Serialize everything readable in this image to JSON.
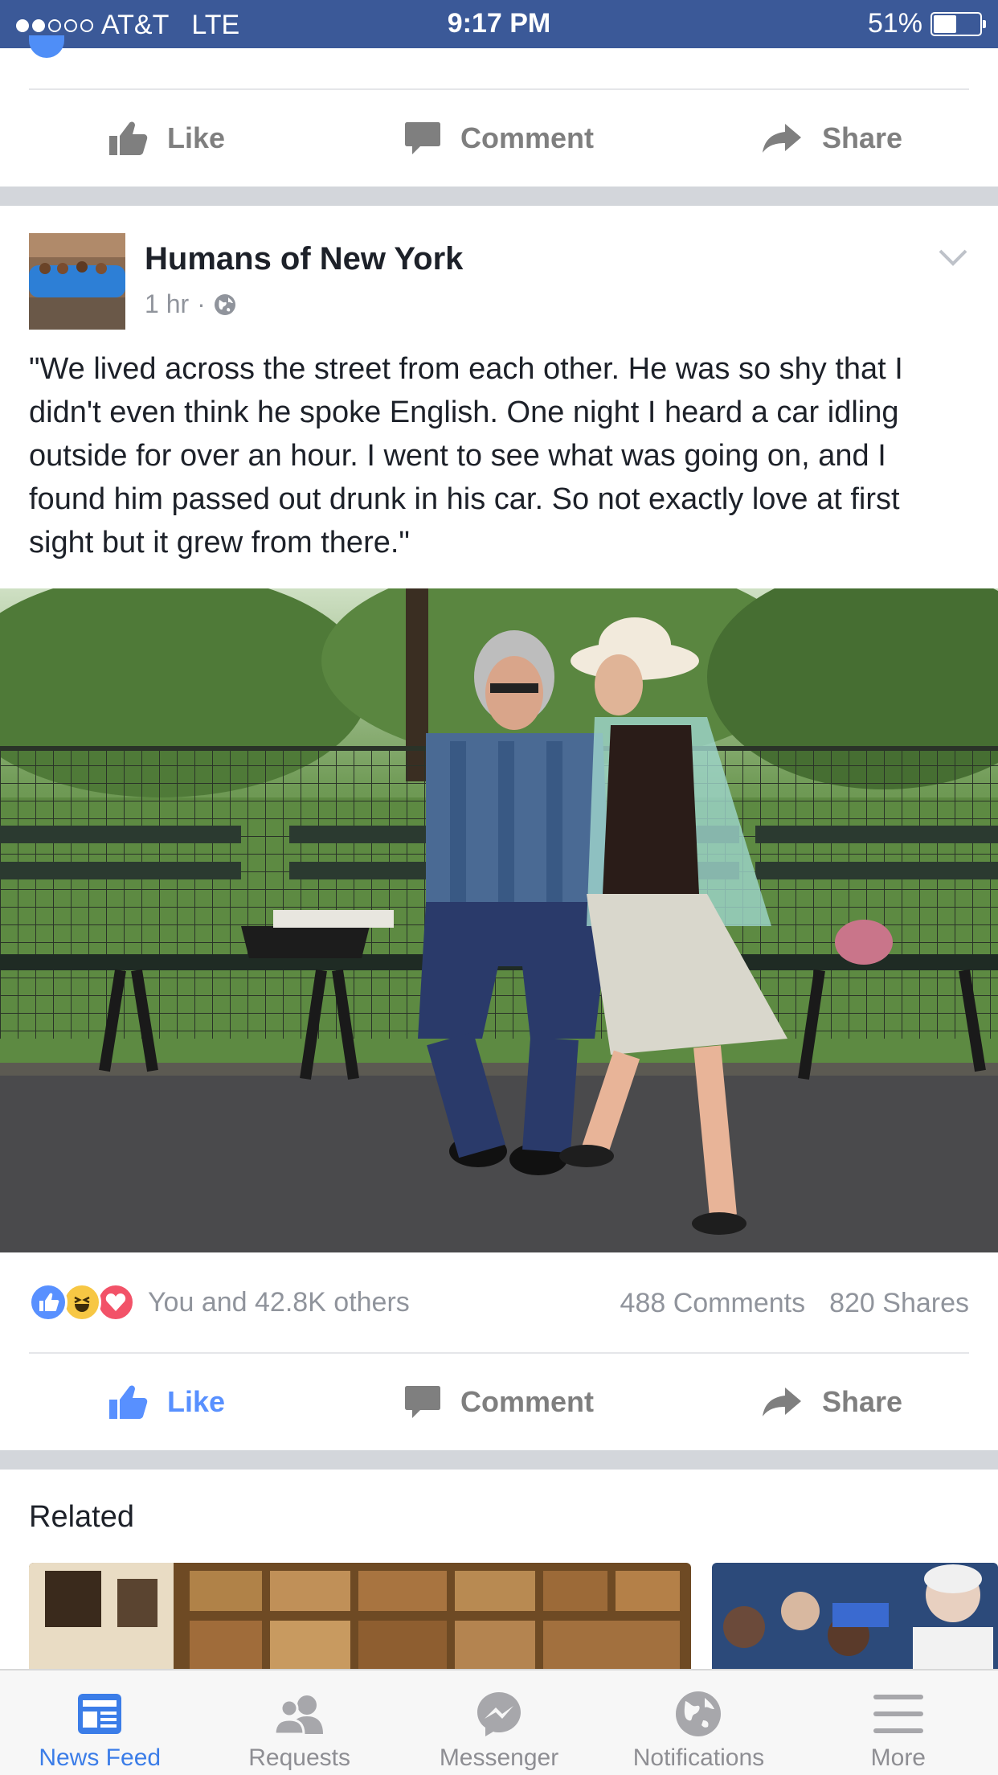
{
  "status_bar": {
    "carrier": "AT&T",
    "network": "LTE",
    "time": "9:17 PM",
    "battery": "51%",
    "battery_level": 0.51,
    "signal_bars": 2
  },
  "prev_post_actions": {
    "like": "Like",
    "comment": "Comment",
    "share": "Share"
  },
  "post": {
    "page_name": "Humans of New York",
    "time": "1 hr",
    "separator": "·",
    "privacy_icon": "globe-icon",
    "text": "\"We lived across the street from each other. He was so shy that I didn't even think he spoke English.  One night I heard a car idling outside for over an hour.  I went to see what was going on, and I found him passed out drunk in his car.  So not exactly love at first sight but it grew from there.\"",
    "reactions_text": "You and 42.8K others",
    "comments_count": "488 Comments",
    "shares_count": "820 Shares",
    "actions": {
      "like": "Like",
      "comment": "Comment",
      "share": "Share"
    },
    "liked": true
  },
  "related": {
    "title": "Related"
  },
  "tab_bar": {
    "items": [
      {
        "label": "News Feed",
        "icon": "news-feed-icon",
        "active": true
      },
      {
        "label": "Requests",
        "icon": "friends-icon",
        "active": false
      },
      {
        "label": "Messenger",
        "icon": "messenger-icon",
        "active": false
      },
      {
        "label": "Notifications",
        "icon": "globe-icon",
        "active": false
      },
      {
        "label": "More",
        "icon": "menu-icon",
        "active": false
      }
    ]
  },
  "colors": {
    "brand": "#3b5998",
    "liked": "#5890ff",
    "muted": "#90949c",
    "active_tab": "#3b7de8"
  }
}
